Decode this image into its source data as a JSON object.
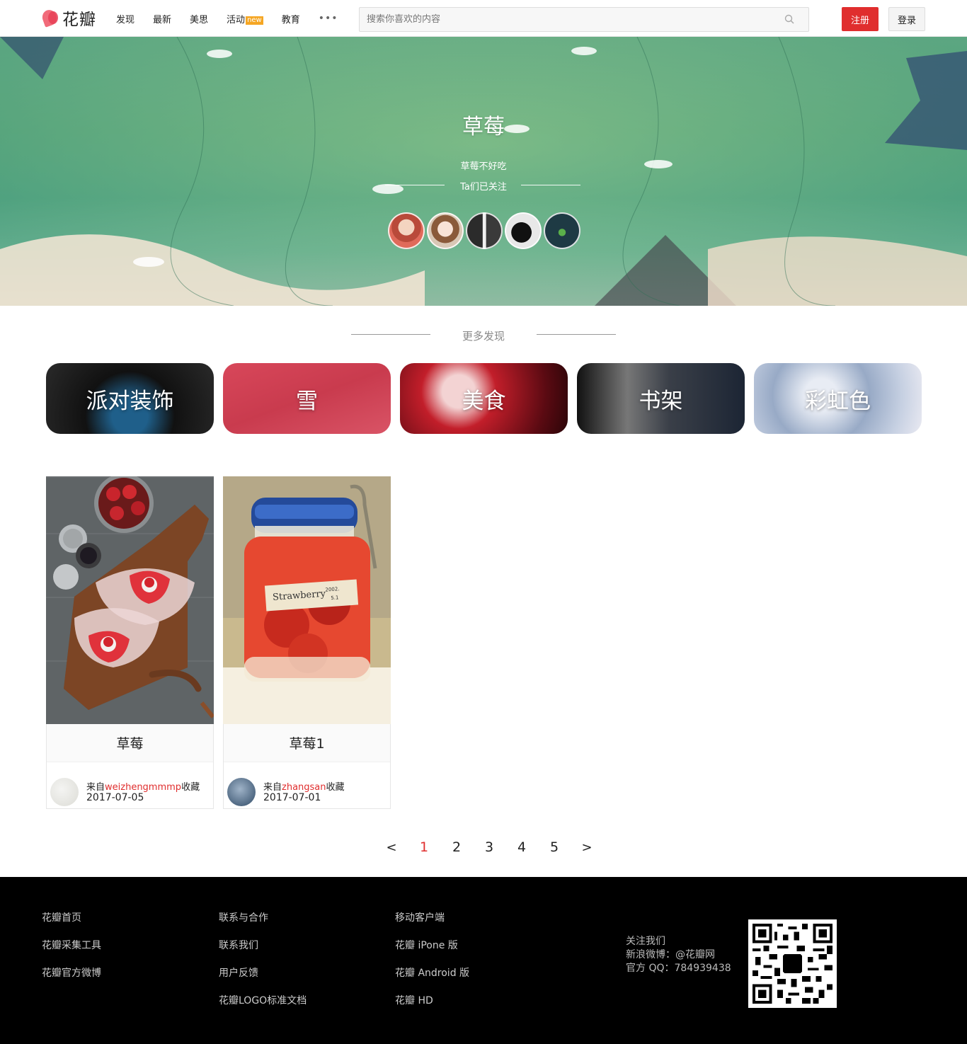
{
  "header": {
    "logo_text": "花瓣",
    "nav": [
      {
        "label": "发现"
      },
      {
        "label": "最新"
      },
      {
        "label": "美思"
      },
      {
        "label": "活动",
        "badge": "new"
      },
      {
        "label": "教育"
      }
    ],
    "more": "•••",
    "search_placeholder": "搜索你喜欢的内容",
    "register": "注册",
    "login": "登录"
  },
  "banner": {
    "title": "草莓",
    "description": "草莓不好吃",
    "followers_label": "Ta们已关注"
  },
  "discover": {
    "title": "更多发现",
    "topics": [
      {
        "label": "派对装饰"
      },
      {
        "label": "雪"
      },
      {
        "label": "美食"
      },
      {
        "label": "书架"
      },
      {
        "label": "彩虹色"
      }
    ]
  },
  "pins": [
    {
      "title": "草莓",
      "from_prefix": "来自",
      "user": "weizhengmmmp",
      "from_suffix": "收藏",
      "date": "2017-07-05"
    },
    {
      "title": "草莓1",
      "from_prefix": "来自",
      "user": "zhangsan",
      "from_suffix": "收藏",
      "date": "2017-07-01"
    }
  ],
  "pagination": {
    "prev": "<",
    "pages": [
      "1",
      "2",
      "3",
      "4",
      "5"
    ],
    "current": "1",
    "next": ">"
  },
  "footer": {
    "col1": [
      "花瓣首页",
      "花瓣采集工具",
      "花瓣官方微博"
    ],
    "col2": [
      "联系与合作",
      "联系我们",
      "用户反馈",
      "花瓣LOGO标准文档"
    ],
    "col3": [
      "移动客户端",
      "花瓣 iPone 版",
      "花瓣 Android 版",
      "花瓣 HD"
    ],
    "follow_title": "关注我们",
    "weibo": "新浪微博：@花瓣网",
    "qq": "官方 QQ：784939438"
  },
  "colors": {
    "brand_red": "#e02e2e",
    "badge_orange": "#f5a623",
    "footer_bg": "#000000"
  }
}
